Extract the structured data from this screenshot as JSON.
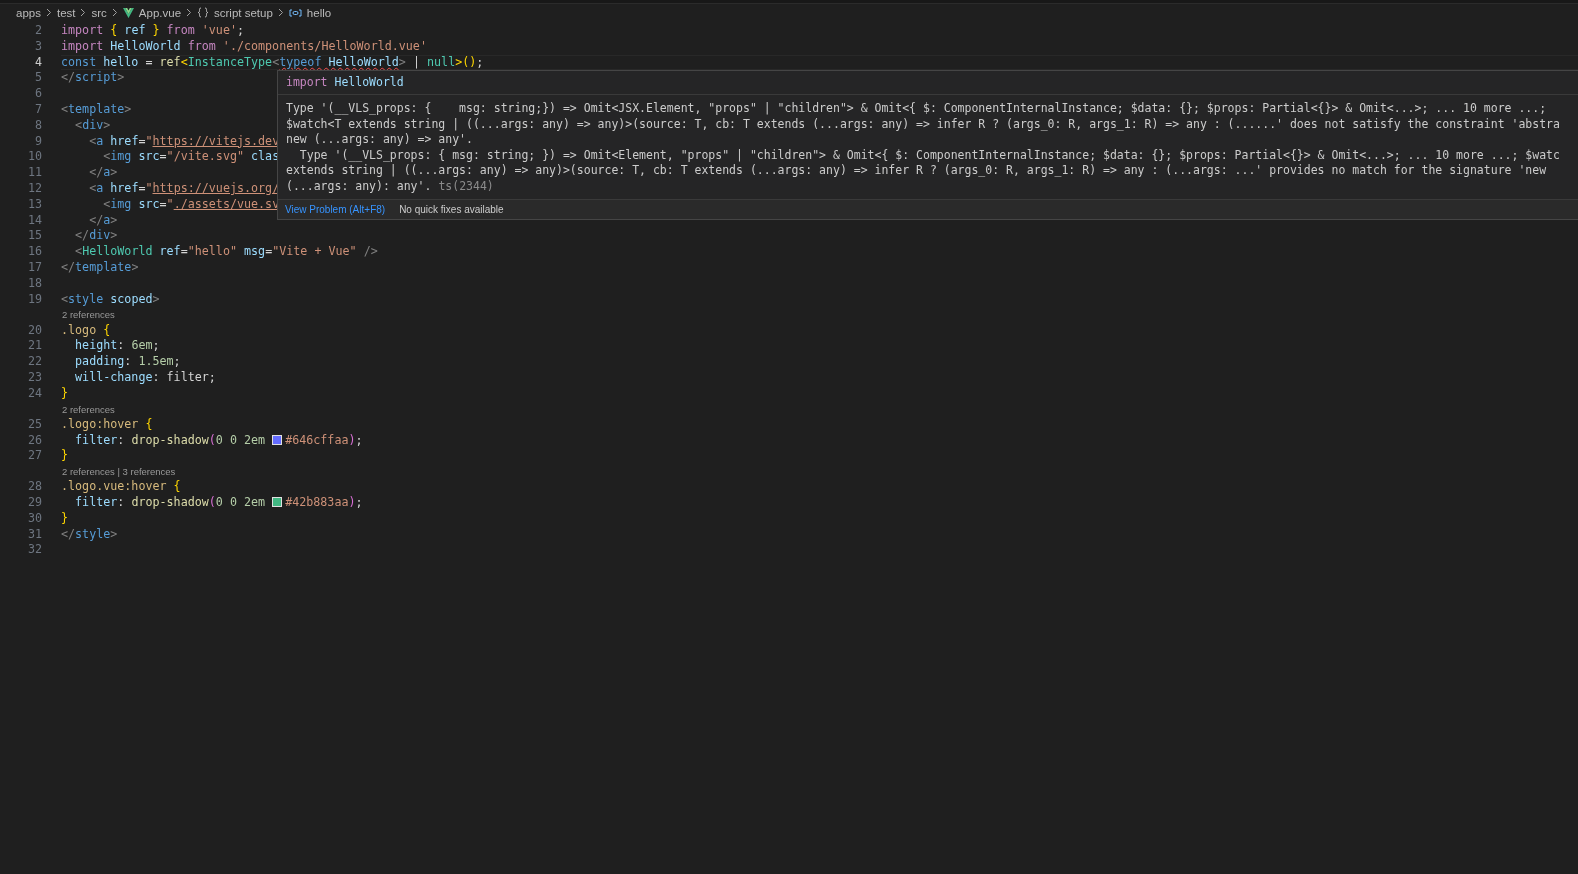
{
  "breadcrumbs": [
    {
      "kind": "folder",
      "label": "apps"
    },
    {
      "kind": "folder",
      "label": "test"
    },
    {
      "kind": "folder",
      "label": "src"
    },
    {
      "kind": "vue-file",
      "label": "App.vue"
    },
    {
      "kind": "braces",
      "label": "script setup"
    },
    {
      "kind": "variable",
      "label": "hello"
    }
  ],
  "editor": {
    "lines": [
      {
        "number": "2",
        "tokens": [
          {
            "kind": "kw",
            "t": "import"
          },
          {
            "kind": "brace",
            "t": " {"
          },
          {
            "kind": "var",
            "t": " ref "
          },
          {
            "kind": "brace",
            "t": "}"
          },
          {
            "kind": "kw",
            "t": " from"
          },
          {
            "kind": "str",
            "t": " 'vue'"
          },
          {
            "kind": "p",
            "t": ";"
          }
        ]
      },
      {
        "number": "3",
        "tokens": [
          {
            "kind": "kw",
            "t": "import"
          },
          {
            "kind": "var",
            "t": " HelloWorld"
          },
          {
            "kind": "kw",
            "t": " from"
          },
          {
            "kind": "str",
            "t": " './components/HelloWorld.vue'"
          }
        ]
      },
      {
        "number": "4",
        "current": true,
        "tokens": [
          {
            "kind": "blue",
            "t": "const"
          },
          {
            "kind": "var",
            "t": " hello"
          },
          {
            "kind": "p",
            "t": " = "
          },
          {
            "kind": "fn",
            "t": "ref"
          },
          {
            "kind": "brace",
            "t": "<"
          },
          {
            "kind": "type",
            "t": "InstanceType"
          },
          {
            "kind": "grey",
            "t": "<"
          },
          {
            "kind": "blue",
            "t": "typeof",
            "error": true
          },
          {
            "kind": "var",
            "t": " HelloWorld",
            "error": true
          },
          {
            "kind": "grey",
            "t": ">"
          },
          {
            "kind": "p",
            "t": " | "
          },
          {
            "kind": "type",
            "t": "null"
          },
          {
            "kind": "brace",
            "t": ">"
          },
          {
            "kind": "brace",
            "t": "()"
          },
          {
            "kind": "p",
            "t": ";"
          }
        ]
      },
      {
        "number": "5",
        "tokens": [
          {
            "kind": "grey",
            "t": "</"
          },
          {
            "kind": "blue",
            "t": "script"
          },
          {
            "kind": "grey",
            "t": ">"
          }
        ]
      },
      {
        "number": "6"
      },
      {
        "number": "7",
        "tokens": [
          {
            "kind": "grey",
            "t": "<"
          },
          {
            "kind": "blue",
            "t": "template"
          },
          {
            "kind": "grey",
            "t": ">"
          }
        ]
      },
      {
        "number": "8",
        "tokens": [
          {
            "kind": "grey",
            "t": "  <"
          },
          {
            "kind": "blue",
            "t": "div"
          },
          {
            "kind": "grey",
            "t": ">"
          }
        ]
      },
      {
        "number": "9",
        "tokens": [
          {
            "kind": "grey",
            "t": "    <"
          },
          {
            "kind": "blue",
            "t": "a"
          },
          {
            "kind": "var",
            "t": " href"
          },
          {
            "kind": "p",
            "t": "="
          },
          {
            "kind": "str",
            "t": "\""
          },
          {
            "kind": "link",
            "t": "https://vitejs.dev"
          }
        ]
      },
      {
        "number": "10",
        "tokens": [
          {
            "kind": "grey",
            "t": "      <"
          },
          {
            "kind": "blue",
            "t": "img"
          },
          {
            "kind": "var",
            "t": " src"
          },
          {
            "kind": "p",
            "t": "="
          },
          {
            "kind": "str",
            "t": "\"/vite.svg\""
          },
          {
            "kind": "var",
            "t": " clas"
          }
        ]
      },
      {
        "number": "11",
        "tokens": [
          {
            "kind": "grey",
            "t": "    </"
          },
          {
            "kind": "blue",
            "t": "a"
          },
          {
            "kind": "grey",
            "t": ">"
          }
        ]
      },
      {
        "number": "12",
        "tokens": [
          {
            "kind": "grey",
            "t": "    <"
          },
          {
            "kind": "blue",
            "t": "a"
          },
          {
            "kind": "var",
            "t": " href"
          },
          {
            "kind": "p",
            "t": "="
          },
          {
            "kind": "str",
            "t": "\""
          },
          {
            "kind": "link",
            "t": "https://vuejs.org/"
          }
        ]
      },
      {
        "number": "13",
        "tokens": [
          {
            "kind": "grey",
            "t": "      <"
          },
          {
            "kind": "blue",
            "t": "img"
          },
          {
            "kind": "var",
            "t": " src"
          },
          {
            "kind": "p",
            "t": "="
          },
          {
            "kind": "str",
            "t": "\""
          },
          {
            "kind": "link",
            "t": "./assets/vue.sv"
          }
        ]
      },
      {
        "number": "14",
        "tokens": [
          {
            "kind": "grey",
            "t": "    </"
          },
          {
            "kind": "blue",
            "t": "a"
          },
          {
            "kind": "grey",
            "t": ">"
          }
        ]
      },
      {
        "number": "15",
        "tokens": [
          {
            "kind": "grey",
            "t": "  </"
          },
          {
            "kind": "blue",
            "t": "div"
          },
          {
            "kind": "grey",
            "t": ">"
          }
        ]
      },
      {
        "number": "16",
        "tokens": [
          {
            "kind": "grey",
            "t": "  <"
          },
          {
            "kind": "type",
            "t": "HelloWorld"
          },
          {
            "kind": "var",
            "t": " ref"
          },
          {
            "kind": "p",
            "t": "="
          },
          {
            "kind": "str",
            "t": "\"hello\""
          },
          {
            "kind": "var",
            "t": " msg"
          },
          {
            "kind": "p",
            "t": "="
          },
          {
            "kind": "str",
            "t": "\"Vite + Vue\""
          },
          {
            "kind": "grey",
            "t": " />"
          }
        ]
      },
      {
        "number": "17",
        "tokens": [
          {
            "kind": "grey",
            "t": "</"
          },
          {
            "kind": "blue",
            "t": "template"
          },
          {
            "kind": "grey",
            "t": ">"
          }
        ]
      },
      {
        "number": "18"
      },
      {
        "number": "19",
        "tokens": [
          {
            "kind": "grey",
            "t": "<"
          },
          {
            "kind": "blue",
            "t": "style"
          },
          {
            "kind": "var",
            "t": " scoped"
          },
          {
            "kind": "grey",
            "t": ">"
          }
        ]
      },
      {
        "kind": "lens",
        "text": "2 references"
      },
      {
        "number": "20",
        "tokens": [
          {
            "kind": "sel",
            "t": ".logo"
          },
          {
            "kind": "brace",
            "t": " {"
          }
        ]
      },
      {
        "number": "21",
        "tokens": [
          {
            "kind": "var",
            "t": "  height"
          },
          {
            "kind": "p",
            "t": ": "
          },
          {
            "kind": "num",
            "t": "6em"
          },
          {
            "kind": "p",
            "t": ";"
          }
        ]
      },
      {
        "number": "22",
        "tokens": [
          {
            "kind": "var",
            "t": "  padding"
          },
          {
            "kind": "p",
            "t": ": "
          },
          {
            "kind": "num",
            "t": "1.5em"
          },
          {
            "kind": "p",
            "t": ";"
          }
        ]
      },
      {
        "number": "23",
        "tokens": [
          {
            "kind": "var",
            "t": "  will-change"
          },
          {
            "kind": "p",
            "t": ": filter;"
          }
        ]
      },
      {
        "number": "24",
        "tokens": [
          {
            "kind": "brace",
            "t": "}"
          }
        ]
      },
      {
        "kind": "lens",
        "text": "2 references"
      },
      {
        "number": "25",
        "tokens": [
          {
            "kind": "sel",
            "t": ".logo:hover"
          },
          {
            "kind": "brace",
            "t": " {"
          }
        ]
      },
      {
        "number": "26",
        "tokens": [
          {
            "kind": "var",
            "t": "  filter"
          },
          {
            "kind": "p",
            "t": ": "
          },
          {
            "kind": "fn",
            "t": "drop-shadow"
          },
          {
            "kind": "paren",
            "t": "("
          },
          {
            "kind": "num",
            "t": "0 0 2em "
          },
          {
            "kind": "swatch",
            "color": "#646cff"
          },
          {
            "kind": "str",
            "t": "#646cffaa"
          },
          {
            "kind": "paren",
            "t": ")"
          },
          {
            "kind": "p",
            "t": ";"
          }
        ]
      },
      {
        "number": "27",
        "tokens": [
          {
            "kind": "brace",
            "t": "}"
          }
        ]
      },
      {
        "kind": "lens",
        "text": "2 references | 3 references"
      },
      {
        "number": "28",
        "tokens": [
          {
            "kind": "sel",
            "t": ".logo.vue:hover"
          },
          {
            "kind": "brace",
            "t": " {"
          }
        ]
      },
      {
        "number": "29",
        "tokens": [
          {
            "kind": "var",
            "t": "  filter"
          },
          {
            "kind": "p",
            "t": ": "
          },
          {
            "kind": "fn",
            "t": "drop-shadow"
          },
          {
            "kind": "paren",
            "t": "("
          },
          {
            "kind": "num",
            "t": "0 0 2em "
          },
          {
            "kind": "swatch",
            "color": "#42b883"
          },
          {
            "kind": "str",
            "t": "#42b883aa"
          },
          {
            "kind": "paren",
            "t": ")"
          },
          {
            "kind": "p",
            "t": ";"
          }
        ]
      },
      {
        "number": "30",
        "tokens": [
          {
            "kind": "brace",
            "t": "}"
          }
        ]
      },
      {
        "number": "31",
        "tokens": [
          {
            "kind": "grey",
            "t": "</"
          },
          {
            "kind": "blue",
            "t": "style"
          },
          {
            "kind": "grey",
            "t": ">"
          }
        ]
      },
      {
        "number": "32"
      }
    ]
  },
  "hover": {
    "header_keyword": "import",
    "header_name": "HelloWorld",
    "message_lines": [
      "Type '(__VLS_props: {    msg: string;}) => Omit<JSX.Element, \"props\" | \"children\"> & Omit<{ $: ComponentInternalInstance; $data: {}; $props: Partial<{}> & Omit<...>; ... 10 more ...;",
      "$watch<T extends string | ((...args: any) => any)>(source: T, cb: T extends (...args: any) => infer R ? (args_0: R, args_1: R) => any : (......' does not satisfy the constraint 'abstra",
      "new (...args: any) => any'.",
      "  Type '(__VLS_props: { msg: string; }) => Omit<Element, \"props\" | \"children\"> & Omit<{ $: ComponentInternalInstance; $data: {}; $props: Partial<{}> & Omit<...>; ... 10 more ...; $watc",
      "extends string | ((...args: any) => any)>(source: T, cb: T extends (...args: any) => infer R ? (args_0: R, args_1: R) => any : (...args: ...' provides no match for the signature 'new",
      "(...args: any): any'."
    ],
    "error_code": "ts(2344)",
    "action": "View Problem (Alt+F8)",
    "note": "No quick fixes available"
  }
}
